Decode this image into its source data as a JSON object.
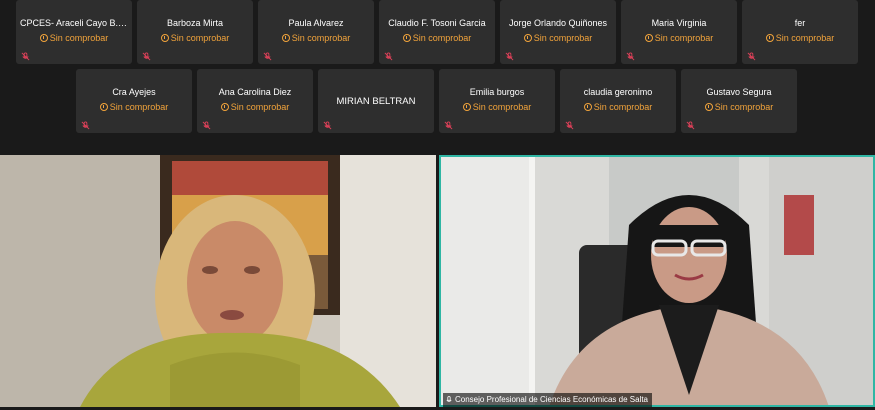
{
  "participants_row1": [
    {
      "name": "CPCES- Araceli Cayo B. Gon...",
      "status": "Sin comprobar"
    },
    {
      "name": "Barboza Mirta",
      "status": "Sin comprobar"
    },
    {
      "name": "Paula Alvarez",
      "status": "Sin comprobar"
    },
    {
      "name": "Claudio F. Tosoni Garcia",
      "status": "Sin comprobar"
    },
    {
      "name": "Jorge Orlando Quiñones",
      "status": "Sin comprobar"
    },
    {
      "name": "Maria Virginia",
      "status": "Sin comprobar"
    },
    {
      "name": "fer",
      "status": "Sin comprobar"
    }
  ],
  "participants_row2": [
    {
      "name": "Cra  Ayejes",
      "status": "Sin comprobar"
    },
    {
      "name": "Ana Carolina Diez",
      "status": "Sin comprobar"
    },
    {
      "name": "MIRIAN BELTRAN",
      "status": ""
    },
    {
      "name": "Emilia burgos",
      "status": "Sin comprobar"
    },
    {
      "name": "claudia geronimo",
      "status": "Sin comprobar"
    },
    {
      "name": "Gustavo Segura",
      "status": "Sin comprobar"
    }
  ],
  "active_speaker": {
    "label": "Consejo Profesional de Ciencias Económicas de Salta"
  },
  "colors": {
    "status": "#f1a33b",
    "active_border": "#2fb6a4",
    "muted_icon": "#e0415a",
    "tile_bg": "#2e2e2e"
  },
  "icons": {
    "muted": "mic-muted-icon",
    "status": "clock-icon",
    "speaker_mic": "mic-icon"
  }
}
